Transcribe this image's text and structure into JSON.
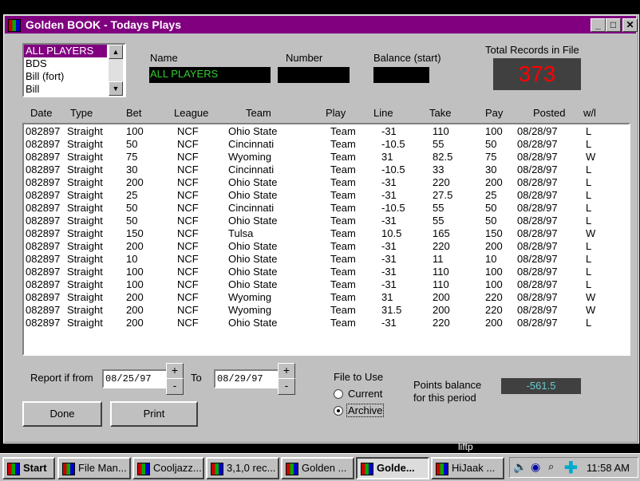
{
  "window": {
    "title": "Golden BOOK - Todays Plays"
  },
  "player_list": [
    "ALL PLAYERS",
    "BDS",
    "Bill (fort)",
    "Bill"
  ],
  "fields": {
    "name_label": "Name",
    "name_value": "ALL PLAYERS",
    "number_label": "Number",
    "number_value": "",
    "balance_label": "Balance (start)",
    "balance_value": "",
    "total_label": "Total Records in File",
    "total_value": "373"
  },
  "columns": [
    "Date",
    "Type",
    "Bet",
    "League",
    "Team",
    "Play",
    "Line",
    "Take",
    "Pay",
    "Posted",
    "w/l"
  ],
  "rows": [
    [
      "082897",
      "Straight",
      "100",
      "NCF",
      "Ohio State",
      "Team",
      "-31",
      "110",
      "100",
      "08/28/97",
      "L"
    ],
    [
      "082897",
      "Straight",
      "50",
      "NCF",
      "Cincinnati",
      "Team",
      "-10.5",
      "55",
      "50",
      "08/28/97",
      "L"
    ],
    [
      "082897",
      "Straight",
      "75",
      "NCF",
      "Wyoming",
      "Team",
      "31",
      "82.5",
      "75",
      "08/28/97",
      "W"
    ],
    [
      "082897",
      "Straight",
      "30",
      "NCF",
      "Cincinnati",
      "Team",
      "-10.5",
      "33",
      "30",
      "08/28/97",
      "L"
    ],
    [
      "082897",
      "Straight",
      "200",
      "NCF",
      "Ohio State",
      "Team",
      "-31",
      "220",
      "200",
      "08/28/97",
      "L"
    ],
    [
      "082897",
      "Straight",
      "25",
      "NCF",
      "Ohio State",
      "Team",
      "-31",
      "27.5",
      "25",
      "08/28/97",
      "L"
    ],
    [
      "082897",
      "Straight",
      "50",
      "NCF",
      "Cincinnati",
      "Team",
      "-10.5",
      "55",
      "50",
      "08/28/97",
      "L"
    ],
    [
      "082897",
      "Straight",
      "50",
      "NCF",
      "Ohio State",
      "Team",
      "-31",
      "55",
      "50",
      "08/28/97",
      "L"
    ],
    [
      "082897",
      "Straight",
      "150",
      "NCF",
      "Tulsa",
      "Team",
      "10.5",
      "165",
      "150",
      "08/28/97",
      "W"
    ],
    [
      "082897",
      "Straight",
      "200",
      "NCF",
      "Ohio State",
      "Team",
      "-31",
      "220",
      "200",
      "08/28/97",
      "L"
    ],
    [
      "082897",
      "Straight",
      "10",
      "NCF",
      "Ohio State",
      "Team",
      "-31",
      "11",
      "10",
      "08/28/97",
      "L"
    ],
    [
      "082897",
      "Straight",
      "100",
      "NCF",
      "Ohio State",
      "Team",
      "-31",
      "110",
      "100",
      "08/28/97",
      "L"
    ],
    [
      "082897",
      "Straight",
      "100",
      "NCF",
      "Ohio State",
      "Team",
      "-31",
      "110",
      "100",
      "08/28/97",
      "L"
    ],
    [
      "082897",
      "Straight",
      "200",
      "NCF",
      "Wyoming",
      "Team",
      "31",
      "200",
      "220",
      "08/28/97",
      "W"
    ],
    [
      "082897",
      "Straight",
      "200",
      "NCF",
      "Wyoming",
      "Team",
      "31.5",
      "200",
      "220",
      "08/28/97",
      "W"
    ],
    [
      "082897",
      "Straight",
      "200",
      "NCF",
      "Ohio State",
      "Team",
      "-31",
      "220",
      "200",
      "08/28/97",
      "L"
    ]
  ],
  "report": {
    "from_label": "Report if from",
    "from_value": "08/25/97",
    "to_label": "To",
    "to_value": "08/29/97",
    "plus": "+",
    "minus": "-"
  },
  "file_to_use": {
    "label": "File to Use",
    "current": "Current",
    "archive": "Archive",
    "selected": "Archive"
  },
  "points": {
    "label_line1": "Points balance",
    "label_line2": "for this period",
    "value": "-561.5"
  },
  "buttons": {
    "done": "Done",
    "print": "Print"
  },
  "status_text": "liftp",
  "taskbar": {
    "start": "Start",
    "tasks": [
      "File Man...",
      "Cooljazz...",
      "3,1,0  rec...",
      "Golden ...",
      "Golde...",
      "HiJaak ..."
    ],
    "clock": "11:58 AM"
  },
  "colors": {
    "title_bar": "#800080",
    "total_value": "#ff0000",
    "name_value": "#33cc33",
    "points_value": "#66cccc"
  }
}
